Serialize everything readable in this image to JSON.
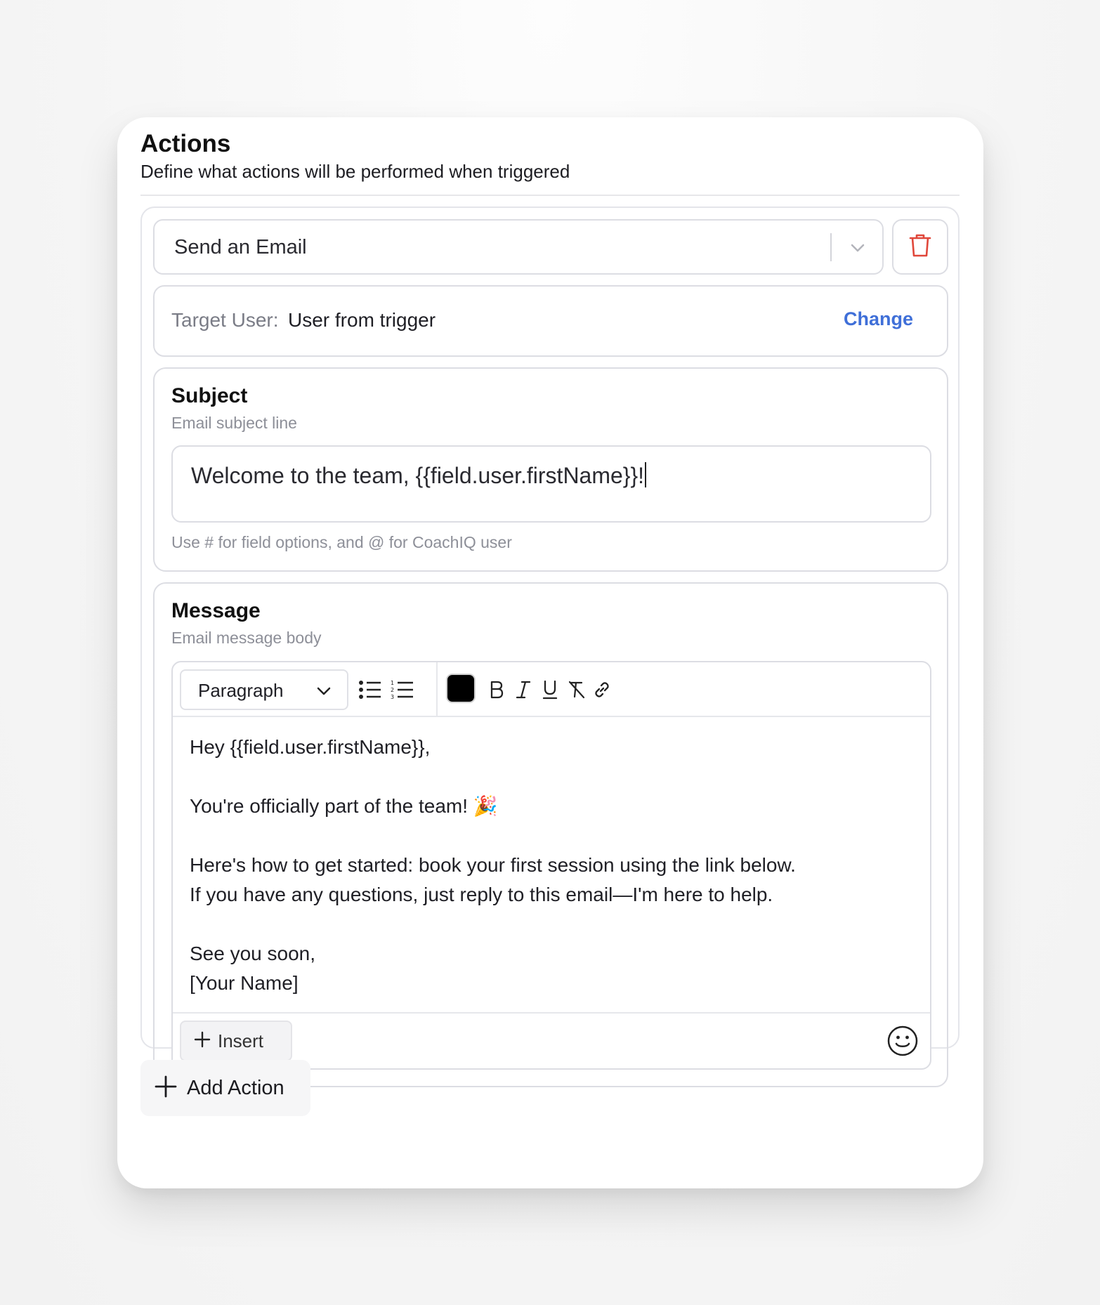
{
  "header": {
    "title": "Actions",
    "subtitle": "Define what actions will be performed when triggered"
  },
  "action": {
    "type_value": "Send an Email",
    "chevron_icon": "chevron-down-icon",
    "delete_icon": "trash-icon",
    "delete_color": "#e0473a"
  },
  "target": {
    "label": "Target User:",
    "value": "User from trigger",
    "change_label": "Change",
    "accent": "#3f6fd8"
  },
  "subject": {
    "title": "Subject",
    "description": "Email subject line",
    "value": "Welcome to the team, {{field.user.firstName}}!",
    "hint": "Use # for field options, and @ for CoachIQ user"
  },
  "message": {
    "title": "Message",
    "description": "Email message body",
    "toolbar": {
      "block_type": "Paragraph",
      "text_color": "#000000",
      "icons": [
        "bulleted-list-icon",
        "numbered-list-icon",
        "text-color-icon",
        "bold-icon",
        "italic-icon",
        "underline-icon",
        "clear-format-icon",
        "link-icon"
      ]
    },
    "body_lines": [
      "Hey {{field.user.firstName}},",
      "",
      "You're officially part of the team! 🎉",
      "",
      "Here's how to get started: book your first session using the link below.",
      "If you have any questions, just reply to this email—I'm here to help.",
      "",
      "See you soon,",
      "[Your Name]"
    ],
    "insert_label": "Insert",
    "emoji_icon": "smiley-icon"
  },
  "footer": {
    "add_action_label": "Add Action"
  }
}
